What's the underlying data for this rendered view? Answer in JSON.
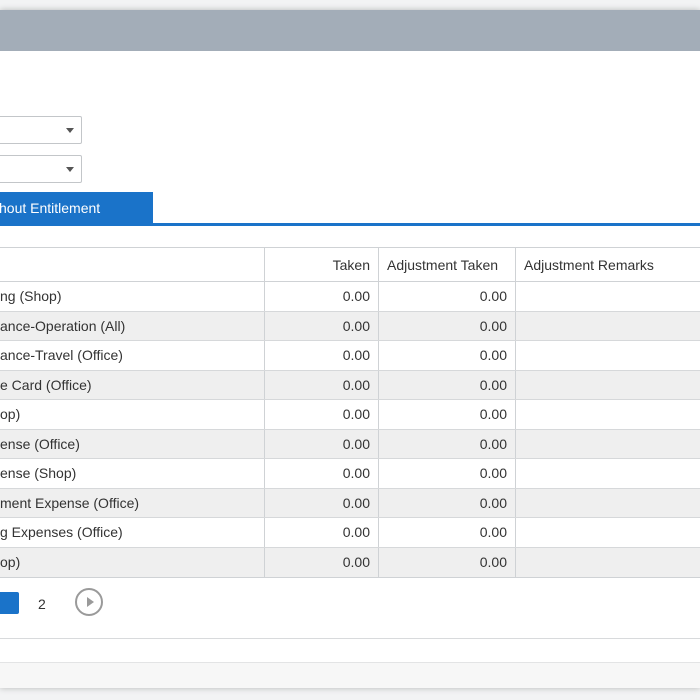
{
  "tab": {
    "label": "hout Entitlement"
  },
  "columns": [
    "",
    "Taken",
    "Adjustment Taken",
    "Adjustment Remarks"
  ],
  "rows": [
    {
      "name": "ng (Shop)",
      "taken": "0.00",
      "adj_taken": "0.00",
      "remarks": ""
    },
    {
      "name": "ance-Operation (All)",
      "taken": "0.00",
      "adj_taken": "0.00",
      "remarks": ""
    },
    {
      "name": "ance-Travel (Office)",
      "taken": "0.00",
      "adj_taken": "0.00",
      "remarks": ""
    },
    {
      "name": "e Card (Office)",
      "taken": "0.00",
      "adj_taken": "0.00",
      "remarks": ""
    },
    {
      "name": "op)",
      "taken": "0.00",
      "adj_taken": "0.00",
      "remarks": ""
    },
    {
      "name": "ense (Office)",
      "taken": "0.00",
      "adj_taken": "0.00",
      "remarks": ""
    },
    {
      "name": "ense (Shop)",
      "taken": "0.00",
      "adj_taken": "0.00",
      "remarks": ""
    },
    {
      "name": "ment Expense (Office)",
      "taken": "0.00",
      "adj_taken": "0.00",
      "remarks": ""
    },
    {
      "name": "g Expenses (Office)",
      "taken": "0.00",
      "adj_taken": "0.00",
      "remarks": ""
    },
    {
      "name": "op)",
      "taken": "0.00",
      "adj_taken": "0.00",
      "remarks": ""
    }
  ],
  "pager": {
    "page_2": "2",
    "next_icon": "chevron-right-circle-icon"
  },
  "colors": {
    "accent": "#1a73c9",
    "titlebar": "#a3adb8"
  }
}
